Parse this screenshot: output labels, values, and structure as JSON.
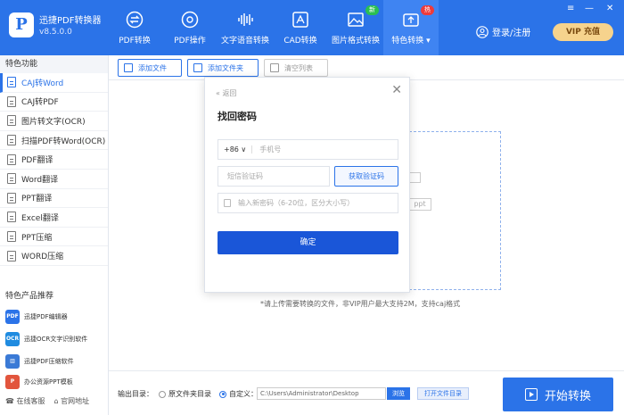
{
  "app": {
    "name": "迅捷PDF转换器",
    "version": "v8.5.0.0",
    "logo_letter": "P"
  },
  "nav": [
    {
      "label": "PDF转换",
      "icon": "swap-icon"
    },
    {
      "label": "PDF操作",
      "icon": "pdf-gear-icon"
    },
    {
      "label": "文字语音转换",
      "icon": "audio-wave-icon"
    },
    {
      "label": "CAD转换",
      "icon": "cad-icon"
    },
    {
      "label": "图片格式转换",
      "icon": "image-icon",
      "badge": "新"
    },
    {
      "label": "特色转换 ▾",
      "icon": "special-icon",
      "badge": "热",
      "active": true
    }
  ],
  "header": {
    "login": "登录/注册",
    "vip": "VIP 充值"
  },
  "window": {
    "menu": "≡",
    "minimize": "—",
    "close": "✕"
  },
  "sidebar": {
    "feature_title": "特色功能",
    "items": [
      "CAJ转Word",
      "CAJ转PDF",
      "图片转文字(OCR)",
      "扫描PDF转Word(OCR)",
      "PDF翻译",
      "Word翻译",
      "PPT翻译",
      "Excel翻译",
      "PPT压缩",
      "WORD压缩"
    ],
    "active_index": 0,
    "products_title": "特色产品推荐",
    "products": [
      {
        "label": "迅捷PDF编辑器",
        "icon_text": "PDF",
        "color": "#2b73e8"
      },
      {
        "label": "迅捷OCR文字识别软件",
        "icon_text": "OCR",
        "color": "#1f8be0"
      },
      {
        "label": "迅捷PDF压缩软件",
        "icon_text": "▥",
        "color": "#3a7ad6"
      },
      {
        "label": "办公资源PPT模板",
        "icon_text": "P",
        "color": "#e2553d"
      }
    ],
    "footer": [
      "在线客服",
      "官网地址"
    ]
  },
  "toolbar": {
    "add_file": "添加文件",
    "add_folder": "添加文件夹",
    "clear": "清空列表"
  },
  "main": {
    "ghost_ppt": "ppt",
    "hint": "*请上传需要转换的文件，非VIP用户最大支持2M，支持caj格式"
  },
  "bottom": {
    "output_label": "输出目录：",
    "option_original": "原文件夹目录",
    "option_custom": "自定义：",
    "path": "C:\\Users\\Administrator\\Desktop",
    "browse": "浏览",
    "open_dir": "打开文件目录",
    "start": "开始转换"
  },
  "modal": {
    "back": "« 返回",
    "close": "✕",
    "title": "找回密码",
    "country_code": "+86 ∨",
    "phone_placeholder": "手机号",
    "code_placeholder": "短信验证码",
    "get_code": "获取验证码",
    "password_placeholder": "输入新密码（6-20位，区分大小写）",
    "confirm": "确定"
  }
}
